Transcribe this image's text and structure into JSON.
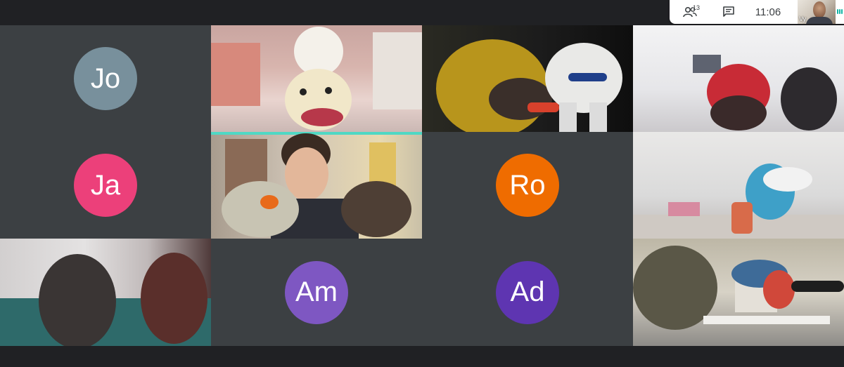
{
  "toolbar": {
    "participants_count": "13",
    "time": "11:06",
    "self_label": "Vy"
  },
  "participants": [
    {
      "initials": "Jo",
      "color": "#78909c"
    },
    {
      "initials": "Ja",
      "color": "#ec407a"
    },
    {
      "initials": "Ro",
      "color": "#ef6c00"
    },
    {
      "initials": "Am",
      "color": "#7e57c2"
    },
    {
      "initials": "Ad",
      "color": "#5e35b1"
    }
  ],
  "active_speaker_color": "#4fd8c4"
}
